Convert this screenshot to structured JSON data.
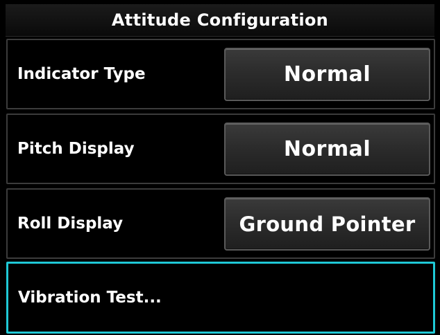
{
  "title": "Attitude Configuration",
  "rows": [
    {
      "label": "Indicator Type",
      "value": "Normal"
    },
    {
      "label": "Pitch Display",
      "value": "Normal"
    },
    {
      "label": "Roll Display",
      "value": "Ground Pointer"
    },
    {
      "label": "Vibration Test..."
    }
  ],
  "colors": {
    "selection_border": "#1fc9d6",
    "background": "#000000",
    "button_face": "#2c2c2c"
  }
}
